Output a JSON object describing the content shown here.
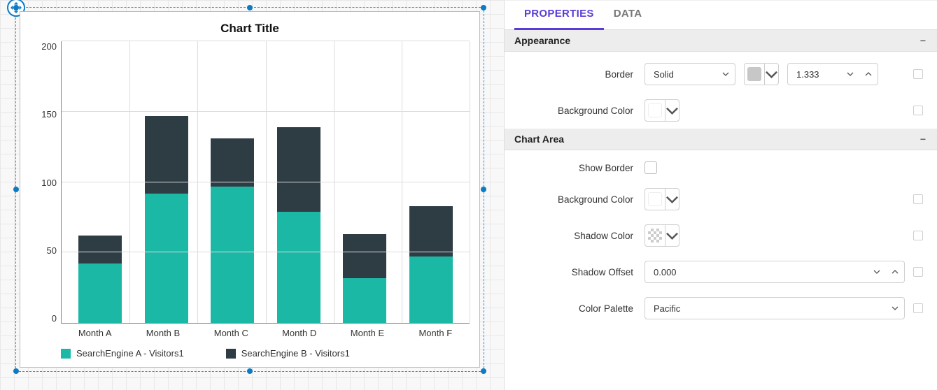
{
  "tabs": {
    "properties": "PROPERTIES",
    "data": "DATA"
  },
  "sections": {
    "appearance": {
      "title": "Appearance",
      "border_label": "Border",
      "border_style": "Solid",
      "border_width": "1.333",
      "bg_label": "Background Color"
    },
    "chart_area": {
      "title": "Chart Area",
      "show_border_label": "Show Border",
      "bg_label": "Background Color",
      "shadow_color_label": "Shadow Color",
      "shadow_offset_label": "Shadow Offset",
      "shadow_offset_value": "0.000",
      "palette_label": "Color Palette",
      "palette_value": "Pacific"
    }
  },
  "legend": {
    "a": "SearchEngine A - Visitors1",
    "b": "SearchEngine B - Visitors1"
  },
  "chart_data": {
    "type": "bar",
    "title": "Chart Title",
    "ylabel": "",
    "xlabel": "",
    "ylim": [
      0,
      200
    ],
    "yticks": [
      0,
      50,
      100,
      150,
      200
    ],
    "categories": [
      "Month A",
      "Month B",
      "Month C",
      "Month D",
      "Month E",
      "Month F"
    ],
    "series": [
      {
        "name": "SearchEngine A - Visitors1",
        "color": "#1cb8a6",
        "values": [
          42,
          92,
          97,
          79,
          32,
          47
        ]
      },
      {
        "name": "SearchEngine B - Visitors1",
        "color": "#2e3d44",
        "values": [
          20,
          55,
          34,
          60,
          31,
          36
        ]
      }
    ]
  }
}
